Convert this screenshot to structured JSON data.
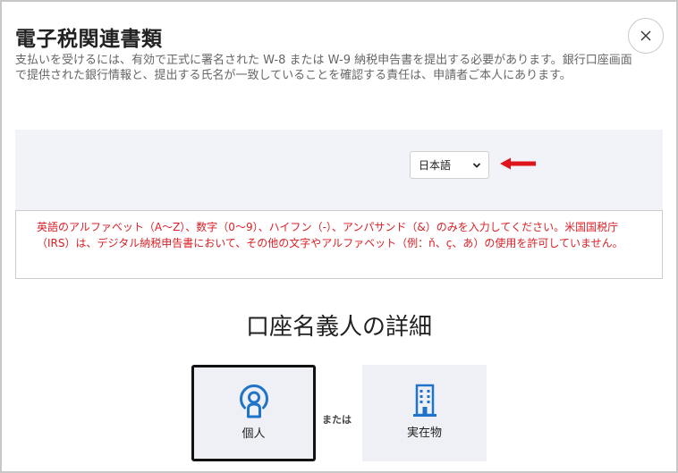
{
  "header": {
    "title": "電子税関連書類",
    "description": "支払いを受けるには、有効で正式に署名された W-8 または W-9 納税申告書を提出する必要があります。銀行口座画面で提供された銀行情報と、提出する氏名が一致していることを確認する責任は、申請者ご本人にあります。"
  },
  "icons": {
    "close": "close-icon",
    "individual": "person-icon",
    "entity": "building-icon",
    "arrow": "arrow-left-icon",
    "dropdown": "chevron-down-icon"
  },
  "language": {
    "selected": "日本語"
  },
  "warning": {
    "text": "英語のアルファベット（A〜Z）、数字（0〜9）、ハイフン（-）、アンパサンド（&）のみを入力してください。米国国税庁（IRS）は、デジタル納税申告書において、その他の文字やアルファベット（例：ň、ç、あ）の使用を許可していません。"
  },
  "account_holder": {
    "title": "口座名義人の詳細",
    "individual_label": "個人",
    "or_label": "または",
    "entity_label": "実在物"
  },
  "colors": {
    "accent_blue": "#1f73c9",
    "warning_red": "#d91f26",
    "arrow_red": "#e0151c",
    "band_bg": "#f2f3f8"
  }
}
